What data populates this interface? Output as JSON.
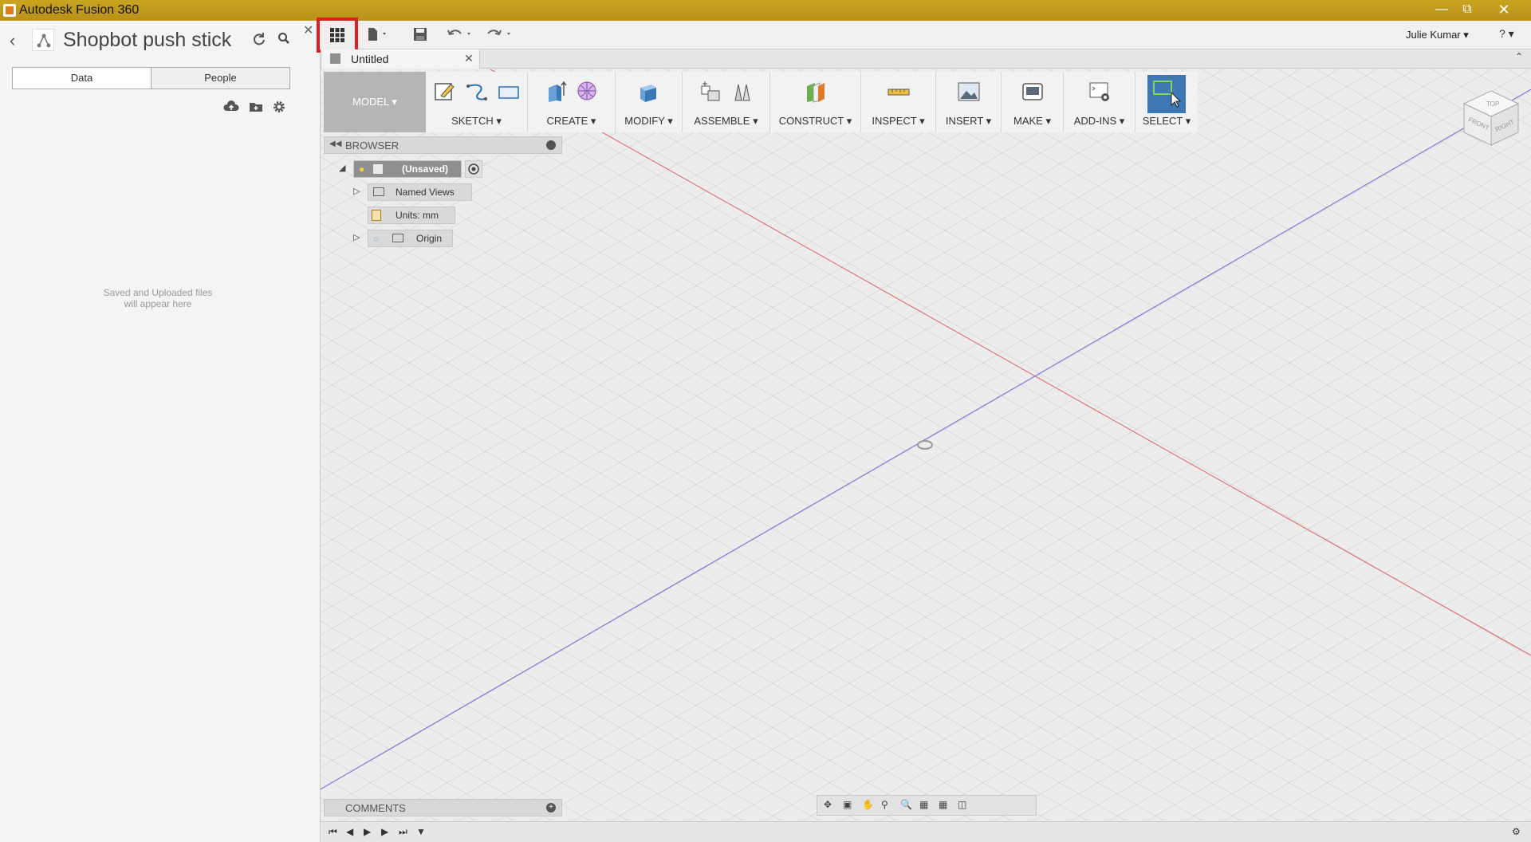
{
  "window": {
    "title": "Autodesk Fusion 360",
    "controls": [
      "minimize-icon",
      "restore-icon",
      "close-icon"
    ]
  },
  "data_panel": {
    "project_title": "Shopbot push stick",
    "tabs": [
      {
        "label": "Data"
      },
      {
        "label": "People"
      }
    ],
    "empty_message_line1": "Saved and Uploaded files",
    "empty_message_line2": "will appear here"
  },
  "topbar": {
    "user_name": "Julie Kumar ▾",
    "help_label": "? ▾"
  },
  "document": {
    "tab_title": "Untitled"
  },
  "toolbar": {
    "workspace": "MODEL ▾",
    "groups": [
      {
        "label": "SKETCH ▾"
      },
      {
        "label": "CREATE ▾"
      },
      {
        "label": "MODIFY ▾"
      },
      {
        "label": "ASSEMBLE ▾"
      },
      {
        "label": "CONSTRUCT ▾"
      },
      {
        "label": "INSPECT ▾"
      },
      {
        "label": "INSERT ▾"
      },
      {
        "label": "MAKE ▾"
      },
      {
        "label": "ADD-INS ▾"
      },
      {
        "label": "SELECT ▾"
      }
    ]
  },
  "browser": {
    "header": "BROWSER",
    "nodes": {
      "root": "(Unsaved)",
      "named_views": "Named Views",
      "units": "Units: mm",
      "origin": "Origin"
    }
  },
  "comments": {
    "header": "COMMENTS"
  },
  "viewcube": {
    "top": "TOP",
    "front": "FRONT",
    "right": "RIGHT"
  },
  "colors": {
    "titlebar": "#c2a01f",
    "highlight_box": "#e01e1e",
    "select_tool": "#3d78b5",
    "x_axis": "#e06060",
    "y_axis": "#6a6ad8"
  }
}
